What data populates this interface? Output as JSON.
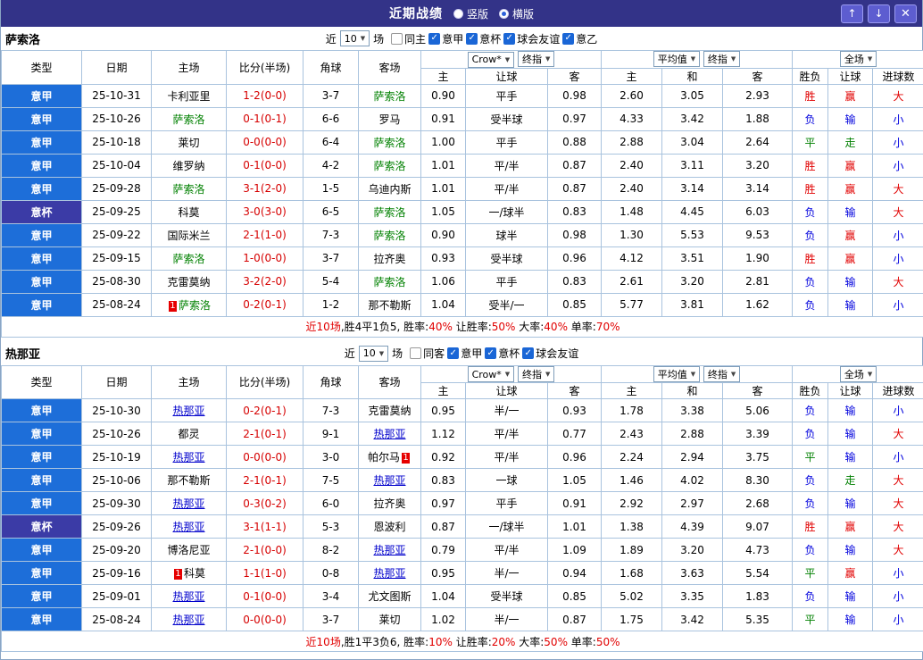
{
  "titlebar": {
    "title": "近期战绩",
    "radios": [
      {
        "label": "竖版",
        "selected": false
      },
      {
        "label": "横版",
        "selected": true
      }
    ],
    "up_icon": "↑",
    "down_icon": "↓",
    "close_icon": "✕"
  },
  "table_header": {
    "type": "类型",
    "date": "日期",
    "home": "主场",
    "score": "比分(半场)",
    "corner": "角球",
    "away": "客场",
    "odds_source": "Crow*",
    "odds_final": "终指",
    "avg": "平均值",
    "avg_final": "终指",
    "scope": "全场",
    "sub": [
      "主",
      "让球",
      "客",
      "主",
      "和",
      "客",
      "胜负",
      "让球",
      "进球数"
    ]
  },
  "colors": {
    "titlebar_navy": "#333388",
    "league_blue": "#1d6ed9",
    "cup_navy": "#3b3ba6",
    "grid_line": "#a9c3de",
    "score_red": "#d60000",
    "result_red": "#e10000",
    "result_blue": "#0000dd",
    "result_green": "#008000",
    "checkbox_blue": "#1a66d6"
  },
  "sections": [
    {
      "team": "萨索洛",
      "team_color": "#008000",
      "team_underline": false,
      "filter": {
        "near_label": "近",
        "count": "10",
        "games_label": "场",
        "checkboxes": [
          {
            "label": "同主",
            "checked": false
          },
          {
            "label": "意甲",
            "checked": true
          },
          {
            "label": "意杯",
            "checked": true
          },
          {
            "label": "球会友谊",
            "checked": true
          },
          {
            "label": "意乙",
            "checked": true
          }
        ]
      },
      "rows": [
        {
          "league": "意甲",
          "date": "25-10-31",
          "home": "卡利亚里",
          "score": "1-2(0-0)",
          "corner": "3-7",
          "away": "萨索洛",
          "away_hl": true,
          "odds_home": "0.90",
          "handicap": "平手",
          "odds_away": "0.98",
          "avg_home": "2.60",
          "avg_draw": "3.05",
          "avg_away": "2.93",
          "result": "胜",
          "handicap_result": "赢",
          "goals_result": "大"
        },
        {
          "league": "意甲",
          "date": "25-10-26",
          "home": "萨索洛",
          "home_hl": true,
          "score": "0-1(0-1)",
          "corner": "6-6",
          "away": "罗马",
          "odds_home": "0.91",
          "handicap": "受半球",
          "odds_away": "0.97",
          "avg_home": "4.33",
          "avg_draw": "3.42",
          "avg_away": "1.88",
          "result": "负",
          "handicap_result": "输",
          "goals_result": "小"
        },
        {
          "league": "意甲",
          "date": "25-10-18",
          "home": "莱切",
          "score": "0-0(0-0)",
          "corner": "6-4",
          "away": "萨索洛",
          "away_hl": true,
          "odds_home": "1.00",
          "handicap": "平手",
          "odds_away": "0.88",
          "avg_home": "2.88",
          "avg_draw": "3.04",
          "avg_away": "2.64",
          "result": "平",
          "handicap_result": "走",
          "goals_result": "小"
        },
        {
          "league": "意甲",
          "date": "25-10-04",
          "home": "维罗纳",
          "score": "0-1(0-0)",
          "corner": "4-2",
          "away": "萨索洛",
          "away_hl": true,
          "odds_home": "1.01",
          "handicap": "平/半",
          "odds_away": "0.87",
          "avg_home": "2.40",
          "avg_draw": "3.11",
          "avg_away": "3.20",
          "result": "胜",
          "handicap_result": "赢",
          "goals_result": "小"
        },
        {
          "league": "意甲",
          "date": "25-09-28",
          "home": "萨索洛",
          "home_hl": true,
          "score": "3-1(2-0)",
          "corner": "1-5",
          "away": "乌迪内斯",
          "odds_home": "1.01",
          "handicap": "平/半",
          "odds_away": "0.87",
          "avg_home": "2.40",
          "avg_draw": "3.14",
          "avg_away": "3.14",
          "result": "胜",
          "handicap_result": "赢",
          "goals_result": "大"
        },
        {
          "league": "意杯",
          "date": "25-09-25",
          "home": "科莫",
          "score": "3-0(3-0)",
          "corner": "6-5",
          "away": "萨索洛",
          "away_hl": true,
          "odds_home": "1.05",
          "handicap": "一/球半",
          "odds_away": "0.83",
          "avg_home": "1.48",
          "avg_draw": "4.45",
          "avg_away": "6.03",
          "result": "负",
          "handicap_result": "输",
          "goals_result": "大"
        },
        {
          "league": "意甲",
          "date": "25-09-22",
          "home": "国际米兰",
          "score": "2-1(1-0)",
          "corner": "7-3",
          "away": "萨索洛",
          "away_hl": true,
          "odds_home": "0.90",
          "handicap": "球半",
          "odds_away": "0.98",
          "avg_home": "1.30",
          "avg_draw": "5.53",
          "avg_away": "9.53",
          "result": "负",
          "handicap_result": "赢",
          "goals_result": "小"
        },
        {
          "league": "意甲",
          "date": "25-09-15",
          "home": "萨索洛",
          "home_hl": true,
          "score": "1-0(0-0)",
          "corner": "3-7",
          "away": "拉齐奥",
          "odds_home": "0.93",
          "handicap": "受半球",
          "odds_away": "0.96",
          "avg_home": "4.12",
          "avg_draw": "3.51",
          "avg_away": "1.90",
          "result": "胜",
          "handicap_result": "赢",
          "goals_result": "小"
        },
        {
          "league": "意甲",
          "date": "25-08-30",
          "home": "克雷莫纳",
          "score": "3-2(2-0)",
          "corner": "5-4",
          "away": "萨索洛",
          "away_hl": true,
          "odds_home": "1.06",
          "handicap": "平手",
          "odds_away": "0.83",
          "avg_home": "2.61",
          "avg_draw": "3.20",
          "avg_away": "2.81",
          "result": "负",
          "handicap_result": "输",
          "goals_result": "大"
        },
        {
          "league": "意甲",
          "date": "25-08-24",
          "home": "萨索洛",
          "home_hl": true,
          "home_card": "1",
          "score": "0-2(0-1)",
          "corner": "1-2",
          "away": "那不勒斯",
          "odds_home": "1.04",
          "handicap": "受半/一",
          "odds_away": "0.85",
          "avg_home": "5.77",
          "avg_draw": "3.81",
          "avg_away": "1.62",
          "result": "负",
          "handicap_result": "输",
          "goals_result": "小"
        }
      ],
      "summary": [
        {
          "t": "近10场",
          "red": true
        },
        {
          "t": ",胜4平1负5, 胜率:",
          "red": false
        },
        {
          "t": "40%",
          "red": true
        },
        {
          "t": " 让胜率:",
          "red": false
        },
        {
          "t": "50%",
          "red": true
        },
        {
          "t": " 大率:",
          "red": false
        },
        {
          "t": "40%",
          "red": true
        },
        {
          "t": " 单率:",
          "red": false
        },
        {
          "t": "70%",
          "red": true
        }
      ]
    },
    {
      "team": "热那亚",
      "team_color": "#0000cc",
      "team_underline": true,
      "filter": {
        "near_label": "近",
        "count": "10",
        "games_label": "场",
        "checkboxes": [
          {
            "label": "同客",
            "checked": false
          },
          {
            "label": "意甲",
            "checked": true
          },
          {
            "label": "意杯",
            "checked": true
          },
          {
            "label": "球会友谊",
            "checked": true
          }
        ]
      },
      "rows": [
        {
          "league": "意甲",
          "date": "25-10-30",
          "home": "热那亚",
          "home_hl": true,
          "score": "0-2(0-1)",
          "corner": "7-3",
          "away": "克雷莫纳",
          "odds_home": "0.95",
          "handicap": "半/一",
          "odds_away": "0.93",
          "avg_home": "1.78",
          "avg_draw": "3.38",
          "avg_away": "5.06",
          "result": "负",
          "handicap_result": "输",
          "goals_result": "小"
        },
        {
          "league": "意甲",
          "date": "25-10-26",
          "home": "都灵",
          "score": "2-1(0-1)",
          "corner": "9-1",
          "away": "热那亚",
          "away_hl": true,
          "odds_home": "1.12",
          "handicap": "平/半",
          "odds_away": "0.77",
          "avg_home": "2.43",
          "avg_draw": "2.88",
          "avg_away": "3.39",
          "result": "负",
          "handicap_result": "输",
          "goals_result": "大"
        },
        {
          "league": "意甲",
          "date": "25-10-19",
          "home": "热那亚",
          "home_hl": true,
          "score": "0-0(0-0)",
          "corner": "3-0",
          "away": "帕尔马",
          "away_card": "1",
          "away_card_after": true,
          "odds_home": "0.92",
          "handicap": "平/半",
          "odds_away": "0.96",
          "avg_home": "2.24",
          "avg_draw": "2.94",
          "avg_away": "3.75",
          "result": "平",
          "handicap_result": "输",
          "goals_result": "小"
        },
        {
          "league": "意甲",
          "date": "25-10-06",
          "home": "那不勒斯",
          "score": "2-1(0-1)",
          "corner": "7-5",
          "away": "热那亚",
          "away_hl": true,
          "odds_home": "0.83",
          "handicap": "一球",
          "odds_away": "1.05",
          "avg_home": "1.46",
          "avg_draw": "4.02",
          "avg_away": "8.30",
          "result": "负",
          "handicap_result": "走",
          "goals_result": "大"
        },
        {
          "league": "意甲",
          "date": "25-09-30",
          "home": "热那亚",
          "home_hl": true,
          "score": "0-3(0-2)",
          "corner": "6-0",
          "away": "拉齐奥",
          "odds_home": "0.97",
          "handicap": "平手",
          "odds_away": "0.91",
          "avg_home": "2.92",
          "avg_draw": "2.97",
          "avg_away": "2.68",
          "result": "负",
          "handicap_result": "输",
          "goals_result": "大"
        },
        {
          "league": "意杯",
          "date": "25-09-26",
          "home": "热那亚",
          "home_hl": true,
          "score": "3-1(1-1)",
          "corner": "5-3",
          "away": "恩波利",
          "odds_home": "0.87",
          "handicap": "一/球半",
          "odds_away": "1.01",
          "avg_home": "1.38",
          "avg_draw": "4.39",
          "avg_away": "9.07",
          "result": "胜",
          "handicap_result": "赢",
          "goals_result": "大"
        },
        {
          "league": "意甲",
          "date": "25-09-20",
          "home": "博洛尼亚",
          "score": "2-1(0-0)",
          "corner": "8-2",
          "away": "热那亚",
          "away_hl": true,
          "odds_home": "0.79",
          "handicap": "平/半",
          "odds_away": "1.09",
          "avg_home": "1.89",
          "avg_draw": "3.20",
          "avg_away": "4.73",
          "result": "负",
          "handicap_result": "输",
          "goals_result": "大"
        },
        {
          "league": "意甲",
          "date": "25-09-16",
          "home": "科莫",
          "home_card": "1",
          "score": "1-1(1-0)",
          "corner": "0-8",
          "away": "热那亚",
          "away_hl": true,
          "odds_home": "0.95",
          "handicap": "半/一",
          "odds_away": "0.94",
          "avg_home": "1.68",
          "avg_draw": "3.63",
          "avg_away": "5.54",
          "result": "平",
          "handicap_result": "赢",
          "goals_result": "小"
        },
        {
          "league": "意甲",
          "date": "25-09-01",
          "home": "热那亚",
          "home_hl": true,
          "score": "0-1(0-0)",
          "corner": "3-4",
          "away": "尤文图斯",
          "odds_home": "1.04",
          "handicap": "受半球",
          "odds_away": "0.85",
          "avg_home": "5.02",
          "avg_draw": "3.35",
          "avg_away": "1.83",
          "result": "负",
          "handicap_result": "输",
          "goals_result": "小"
        },
        {
          "league": "意甲",
          "date": "25-08-24",
          "home": "热那亚",
          "home_hl": true,
          "score": "0-0(0-0)",
          "corner": "3-7",
          "away": "莱切",
          "odds_home": "1.02",
          "handicap": "半/一",
          "odds_away": "0.87",
          "avg_home": "1.75",
          "avg_draw": "3.42",
          "avg_away": "5.35",
          "result": "平",
          "handicap_result": "输",
          "goals_result": "小"
        }
      ],
      "summary": [
        {
          "t": "近10场",
          "red": true
        },
        {
          "t": ",胜1平3负6, 胜率:",
          "red": false
        },
        {
          "t": "10%",
          "red": true
        },
        {
          "t": " 让胜率:",
          "red": false
        },
        {
          "t": "20%",
          "red": true
        },
        {
          "t": " 大率:",
          "red": false
        },
        {
          "t": "50%",
          "red": true
        },
        {
          "t": " 单率:",
          "red": false
        },
        {
          "t": "50%",
          "red": true
        }
      ]
    }
  ]
}
